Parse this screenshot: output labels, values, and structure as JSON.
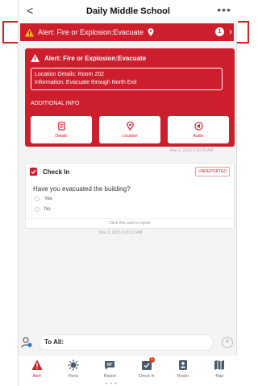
{
  "header": {
    "title": "Daily Middle School",
    "back_glyph": "<",
    "more_glyph": "•••"
  },
  "alert_strip": {
    "text": "Alert: Fire or Explosion:Evacuate",
    "count": "1",
    "chevron": "›"
  },
  "alert_card": {
    "title": "Alert: Fire or Explosion:Evacuate",
    "location_details": "Location Details: Room 202",
    "information": "Information: Evacuate through North Exit",
    "additional_info_label": "ADDITIONAL INFO",
    "tiles": [
      {
        "label": "Details",
        "icon": "details-icon"
      },
      {
        "label": "Location",
        "icon": "location-pin-icon"
      },
      {
        "label": "Audio",
        "icon": "audio-icon"
      }
    ],
    "timestamp": "Mar 3, 2023 9:20:09 AM"
  },
  "check_in": {
    "title": "Check In",
    "status": "UNREPORTED",
    "question": "Have you evacuated the building?",
    "options": [
      "Yes",
      "No"
    ],
    "footer": "Click this card to report",
    "timestamp": "Mar 3, 2023 9:20:22 AM"
  },
  "compose": {
    "label": "To All:",
    "plus_glyph": "+"
  },
  "nav": {
    "items": [
      {
        "label": "Alert",
        "icon": "alert-icon",
        "active": true
      },
      {
        "label": "Panic",
        "icon": "panic-icon"
      },
      {
        "label": "Report",
        "icon": "report-icon"
      },
      {
        "label": "Check In",
        "icon": "check-in-icon",
        "badge": "1"
      },
      {
        "label": "Roster",
        "icon": "roster-icon"
      },
      {
        "label": "Map",
        "icon": "map-icon"
      }
    ]
  },
  "colors": {
    "accent": "#cc1e2c",
    "outline": "#d32020"
  }
}
